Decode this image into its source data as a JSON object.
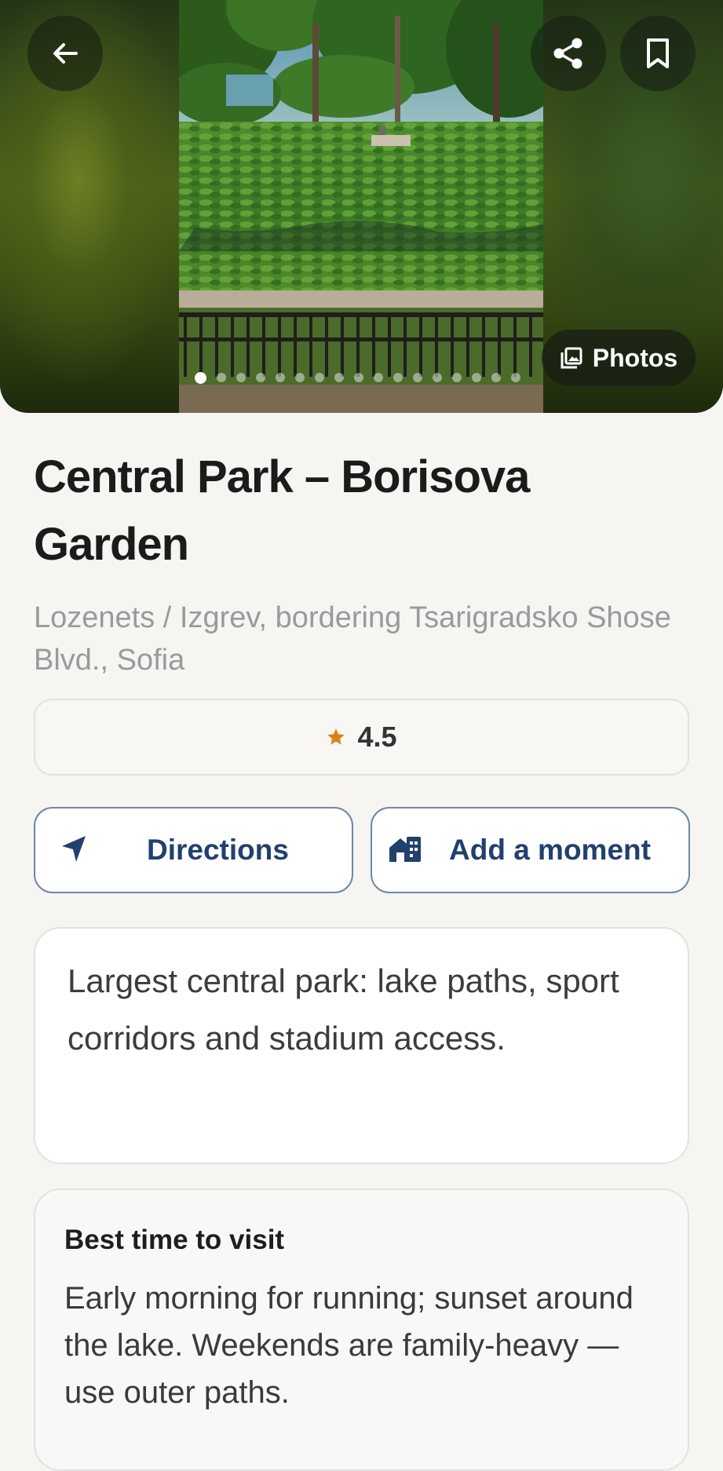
{
  "hero": {
    "photos_label": "Photos",
    "photo_count": 17,
    "active_photo_index": 0
  },
  "place": {
    "title": "Central Park – Borisova Garden",
    "address": "Lozenets / Izgrev, bordering Tsarigradsko Shose Blvd., Sofia",
    "rating": "4.5"
  },
  "actions": {
    "directions_label": "Directions",
    "add_moment_label": "Add a moment"
  },
  "description": "Largest central park: lake paths, sport corridors and stadium access.",
  "best_time": {
    "heading": "Best time to visit",
    "text": "Early morning for running; sunset around the lake. Weekends are family-heavy — use outer paths."
  },
  "icons": {
    "back": "arrow-left-icon",
    "share": "share-icon",
    "save": "bookmark-icon",
    "photos": "gallery-icon",
    "rating": "star-icon",
    "directions": "navigation-arrow-icon",
    "add_moment": "add-home-icon"
  },
  "colors": {
    "accent": "#22406e",
    "star": "#d9821b",
    "background": "#f6f5f2"
  }
}
